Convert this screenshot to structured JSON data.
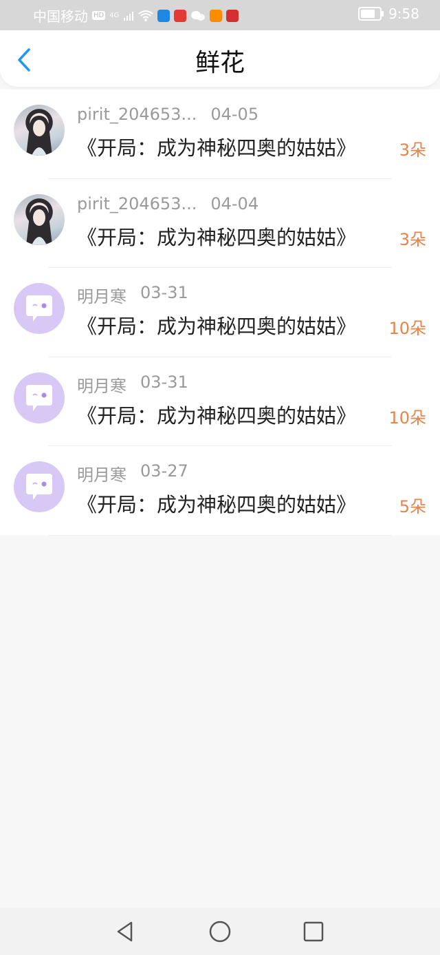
{
  "status_bar": {
    "carrier": "中国移动",
    "hd_badge": "HD",
    "network": "4G",
    "time": "9:58"
  },
  "header": {
    "title": "鲜花",
    "back_icon": "chevron-left-icon",
    "accent_color": "#2196f3"
  },
  "gifts": [
    {
      "user": "pirit_204653...",
      "date": "04-05",
      "book": "《开局：成为神秘四奥的姑姑》",
      "count": "3朵",
      "avatar": "photo"
    },
    {
      "user": "pirit_204653...",
      "date": "04-04",
      "book": "《开局：成为神秘四奥的姑姑》",
      "count": "3朵",
      "avatar": "photo"
    },
    {
      "user": "明月寒",
      "date": "03-31",
      "book": "《开局：成为神秘四奥的姑姑》",
      "count": "10朵",
      "avatar": "bubble"
    },
    {
      "user": "明月寒",
      "date": "03-31",
      "book": "《开局：成为神秘四奥的姑姑》",
      "count": "10朵",
      "avatar": "bubble"
    },
    {
      "user": "明月寒",
      "date": "03-27",
      "book": "《开局：成为神秘四奥的姑姑》",
      "count": "5朵",
      "avatar": "bubble"
    }
  ],
  "colors": {
    "count": "#e8834a",
    "avatar_bubble": "#d7c8f5"
  },
  "nav_bar": {
    "back_icon": "triangle-back-icon",
    "home_icon": "circle-home-icon",
    "recents_icon": "square-recents-icon"
  }
}
